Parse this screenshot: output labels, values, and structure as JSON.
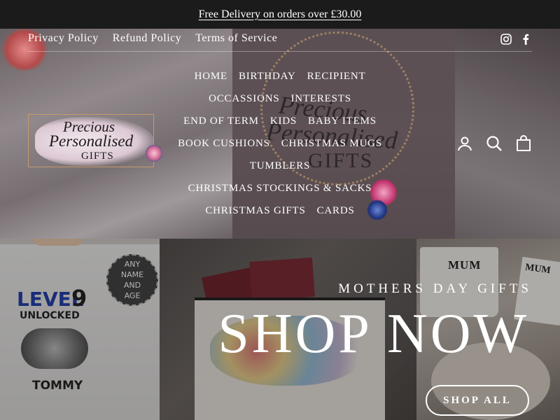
{
  "announcement": {
    "text": "Free Delivery on orders over £30.00"
  },
  "top_links": [
    "Privacy Policy",
    "Refund Policy",
    "Terms of Service"
  ],
  "social": [
    "instagram-icon",
    "facebook-icon"
  ],
  "logo": {
    "line1": "Precious",
    "line2": "Personalised",
    "line3": "GIFTS"
  },
  "header_image_text": {
    "line1": "Precious",
    "line2": "Personalised",
    "line3": "GIFTS"
  },
  "nav": {
    "rows": [
      [
        "HOME",
        "BIRTHDAY",
        "RECIPIENT"
      ],
      [
        "OCCASSIONS",
        "INTERESTS"
      ],
      [
        "END OF TERM",
        "KIDS",
        "BABY ITEMS"
      ],
      [
        "BOOK CUSHIONS",
        "CHRISTMAS MUGS"
      ],
      [
        "TUMBLERS"
      ],
      [
        "CHRISTMAS STOCKINGS & SACKS"
      ],
      [
        "CHRISTMAS GIFTS",
        "CARDS"
      ]
    ]
  },
  "header_icons": [
    "account-icon",
    "search-icon",
    "cart-icon"
  ],
  "banner": {
    "kicker": "MOTHERS DAY GIFTS",
    "headline": "SHOP NOW",
    "cta": "SHOP ALL",
    "tshirt": {
      "level": "LEVEL",
      "number": "9",
      "unlocked": "UNLOCKED",
      "name": "TOMMY"
    },
    "badge": [
      "ANY",
      "NAME",
      "AND",
      "AGE"
    ],
    "mug_text": "MUM",
    "card_text": "MUM"
  },
  "colors": {
    "announcement_bg": "#1b1b1b",
    "text": "#ffffff",
    "level_blue": "#1d3aa8"
  }
}
